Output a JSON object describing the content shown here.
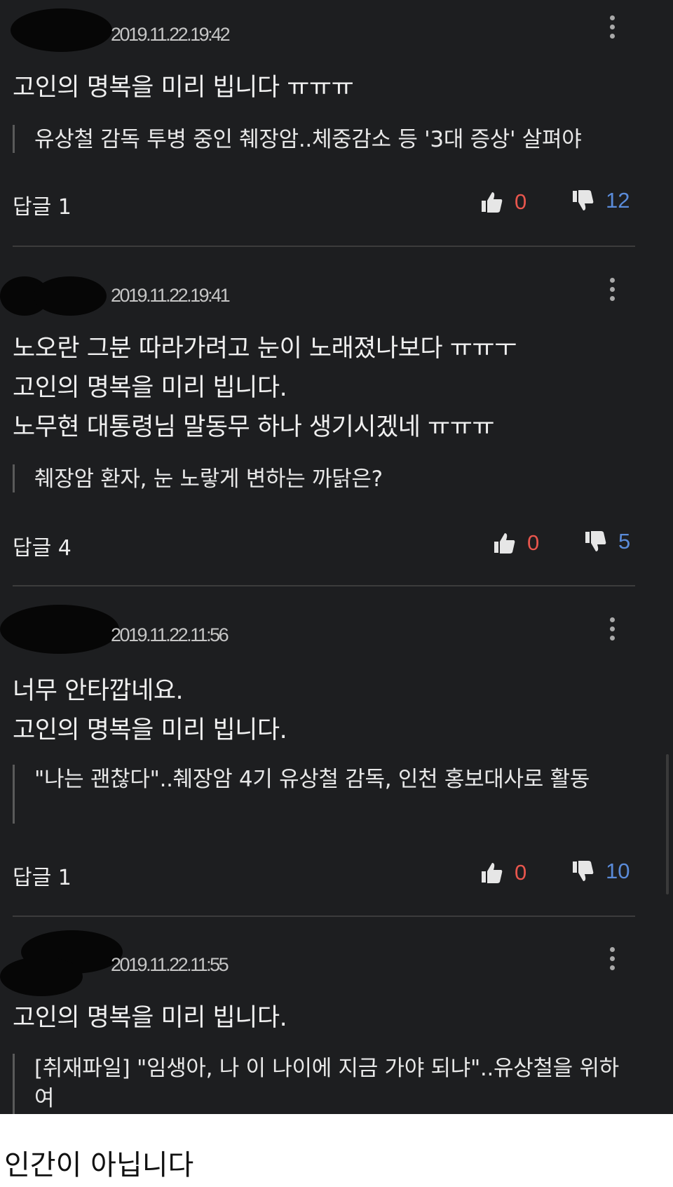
{
  "comments": [
    {
      "timestamp": "2019.11.22.19:42",
      "lines": [
        "고인의 명복을 미리 빕니다 ㅠㅠㅠ"
      ],
      "quote": "유상철 감독 투병 중인 췌장암..체중감소 등 '3대 증상' 살펴야",
      "reply_label": "답글 1",
      "likes": "0",
      "dislikes": "12"
    },
    {
      "timestamp": "2019.11.22.19:41",
      "lines": [
        "노오란 그분 따라가려고 눈이 노래졌나보다 ㅠㅠㅜ",
        "고인의 명복을 미리 빕니다.",
        "노무현 대통령님 말동무 하나 생기시겠네 ㅠㅠㅠ"
      ],
      "quote": "췌장암 환자, 눈 노랗게 변하는 까닭은?",
      "reply_label": "답글 4",
      "likes": "0",
      "dislikes": "5"
    },
    {
      "timestamp": "2019.11.22.11:56",
      "lines": [
        "너무 안타깝네요.",
        "고인의 명복을 미리 빕니다."
      ],
      "quote": "\"나는 괜찮다\"..췌장암 4기 유상철 감독, 인천 홍보대사로 활동",
      "reply_label": "답글 1",
      "likes": "0",
      "dislikes": "10"
    },
    {
      "timestamp": "2019.11.22.11:55",
      "lines": [
        "고인의 명복을 미리 빕니다."
      ],
      "quote": "[취재파일] \"임생아, 나 이 나이에 지금 가야 되냐\"..유상철을 위하여",
      "reply_label": "",
      "likes": "",
      "dislikes": ""
    }
  ],
  "caption": "인간이 아닙니다",
  "icons": {
    "like": "thumbs-up-icon",
    "dislike": "thumbs-down-icon",
    "more": "more-vertical-icon"
  },
  "colors": {
    "background": "#1d1e20",
    "like_count": "#e8564d",
    "dislike_count": "#5a8bd9"
  }
}
